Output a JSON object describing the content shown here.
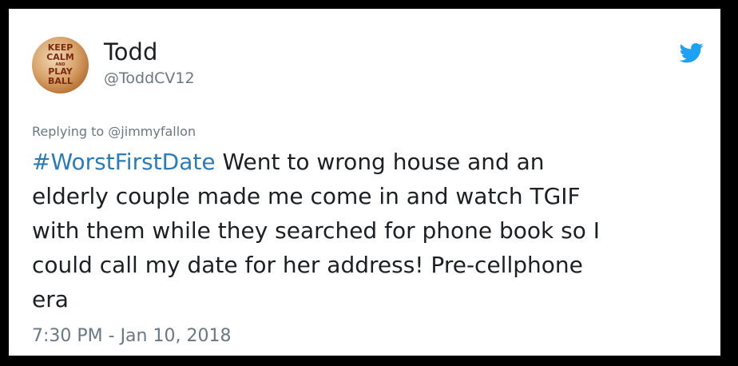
{
  "tweet": {
    "author": {
      "name": "Todd",
      "handle": "@ToddCV12",
      "avatar_text": [
        "KEEP",
        "CALM",
        "AND",
        "PLAY",
        "BALL"
      ]
    },
    "reply": {
      "prefix": "Replying to ",
      "mention": "@jimmyfallon"
    },
    "hashtag": "#WorstFirstDate",
    "text": " Went to wrong house and an\nelderly couple made me come in and watch TGIF\nwith them while they searched for phone book so I\ncould call my date for her address! Pre-cellphone\nera",
    "timestamp": "7:30 PM - Jan 10, 2018",
    "icon": "twitter-bird-icon"
  },
  "colors": {
    "background": "#000000",
    "card": "#ffffff",
    "text": "#1c2022",
    "muted": "#697882",
    "link": "#2b7bb9",
    "bird": "#1da1f2"
  }
}
